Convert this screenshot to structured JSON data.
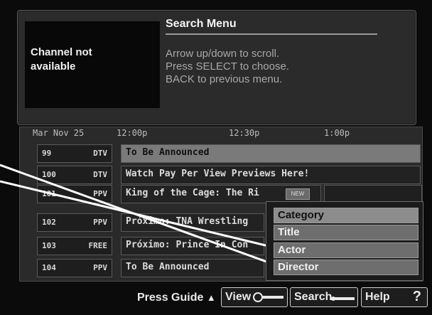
{
  "info_panel": {
    "preview_text": "Channel not\navailable",
    "menu_title": "Search Menu",
    "instructions": [
      "Arrow up/down to scroll.",
      "Press SELECT to choose.",
      "BACK to previous menu."
    ]
  },
  "guide": {
    "date": "Mar Nov 25",
    "times": [
      "12:00p",
      "12:30p",
      "1:00p"
    ],
    "rows": [
      {
        "num": "99",
        "net": "DTV",
        "program": "To Be Announced"
      },
      {
        "num": "100",
        "net": "DTV",
        "program": "Watch Pay Per View Previews Here!"
      },
      {
        "num": "101",
        "net": "PPV",
        "program": "King of the Cage: The Ri"
      },
      {
        "num": "102",
        "net": "PPV",
        "program": "Próximo: TNA Wrestling"
      },
      {
        "num": "103",
        "net": "FREE",
        "program": "Próximo: Prince In Con"
      },
      {
        "num": "104",
        "net": "PPV",
        "program": "To Be Announced"
      }
    ],
    "badge": "NEW"
  },
  "search_options": {
    "items": [
      "Category",
      "Title",
      "Actor",
      "Director"
    ],
    "selected": "Category"
  },
  "bottom_bar": {
    "press_guide": "Press Guide",
    "view": "View",
    "search": "Search",
    "help": "Help",
    "help_symbol": "?"
  },
  "colors": {
    "background": "#0b0b0b",
    "panel": "#2b2b2b",
    "highlight": "#8c8c8c",
    "text": "#e6e6e6"
  }
}
